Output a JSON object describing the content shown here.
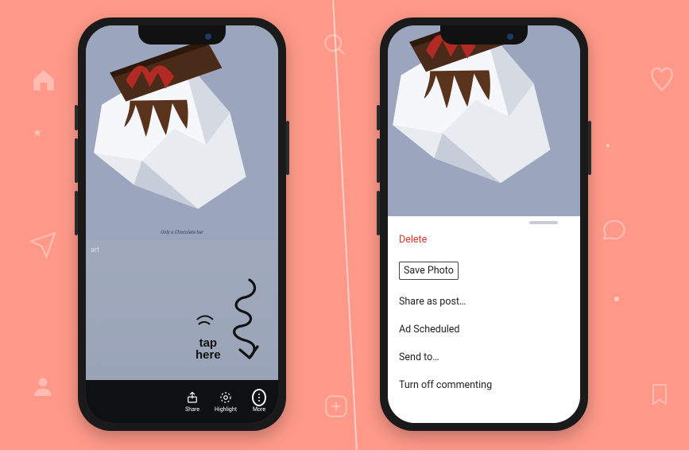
{
  "annotation": {
    "tap": "tap",
    "here": "here"
  },
  "story": {
    "text": "art",
    "photo_caption": "Only a Chocolate bar",
    "bottombar": {
      "share": "Share",
      "highlight": "Highlight",
      "more": "More"
    }
  },
  "sheet": {
    "delete": "Delete",
    "save_photo": "Save Photo",
    "share_as_post": "Share as post…",
    "ad_scheduled": "Ad Scheduled",
    "send_to": "Send to…",
    "turn_off_commenting": "Turn off commenting"
  }
}
